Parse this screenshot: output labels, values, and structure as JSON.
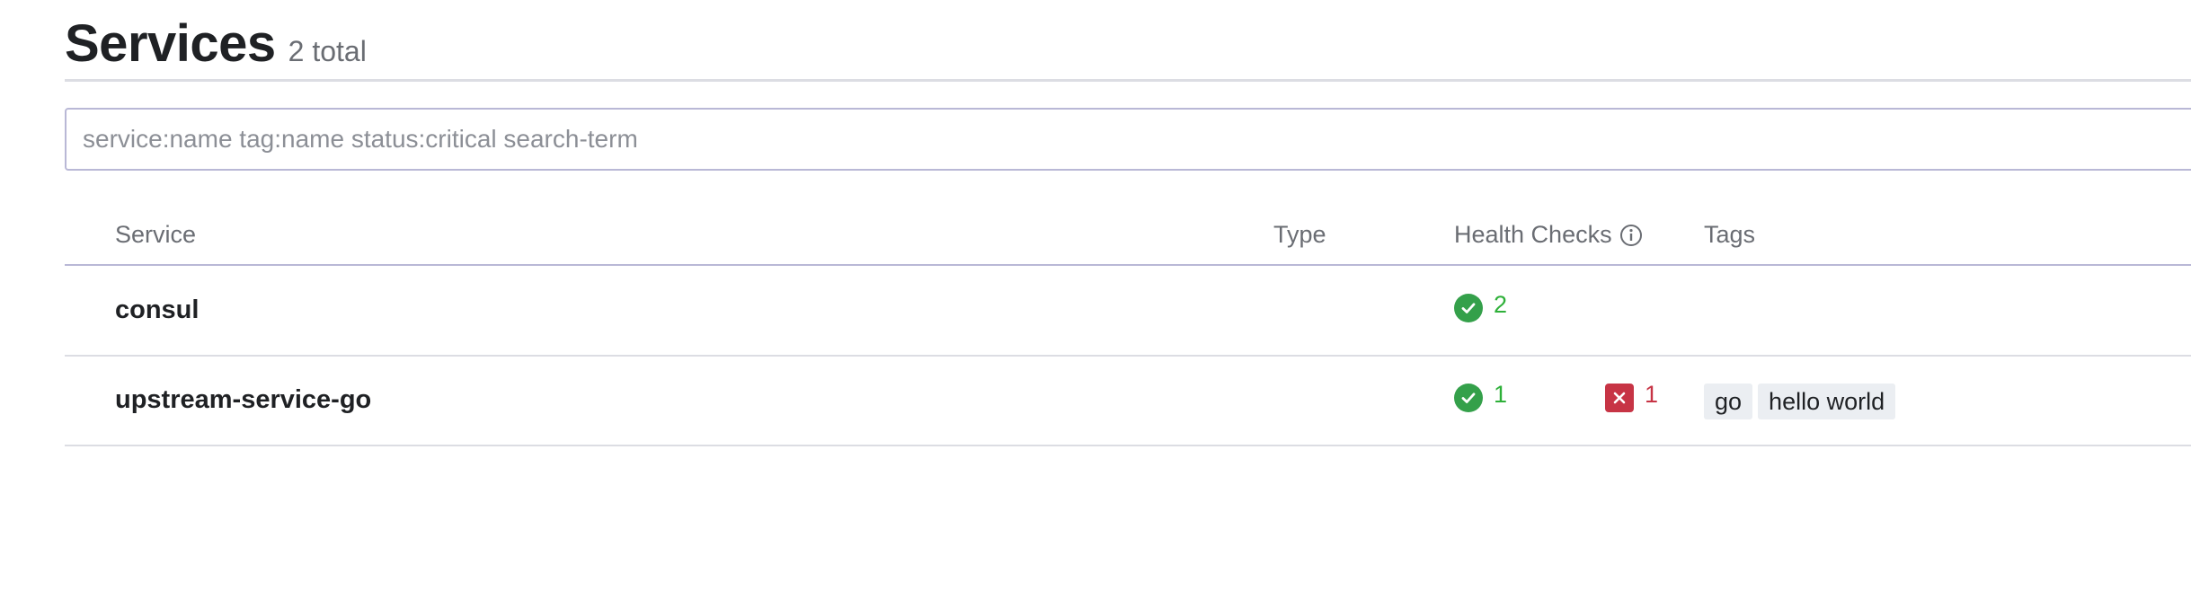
{
  "header": {
    "title": "Services",
    "count": "2 total"
  },
  "search": {
    "placeholder": "service:name tag:name status:critical search-term",
    "value": ""
  },
  "table": {
    "columns": {
      "service": "Service",
      "type": "Type",
      "health": "Health Checks",
      "tags": "Tags"
    },
    "rows": [
      {
        "name": "consul",
        "passing": "2",
        "critical": "",
        "tags": []
      },
      {
        "name": "upstream-service-go",
        "passing": "1",
        "critical": "1",
        "tags": [
          "go",
          "hello world"
        ]
      }
    ]
  },
  "colors": {
    "passing": "#2eb039",
    "critical": "#c73445",
    "accent": "#b9b8d6"
  },
  "icons": {
    "passing": "check-circle-icon",
    "critical": "x-square-icon",
    "info": "info-circle-icon"
  }
}
